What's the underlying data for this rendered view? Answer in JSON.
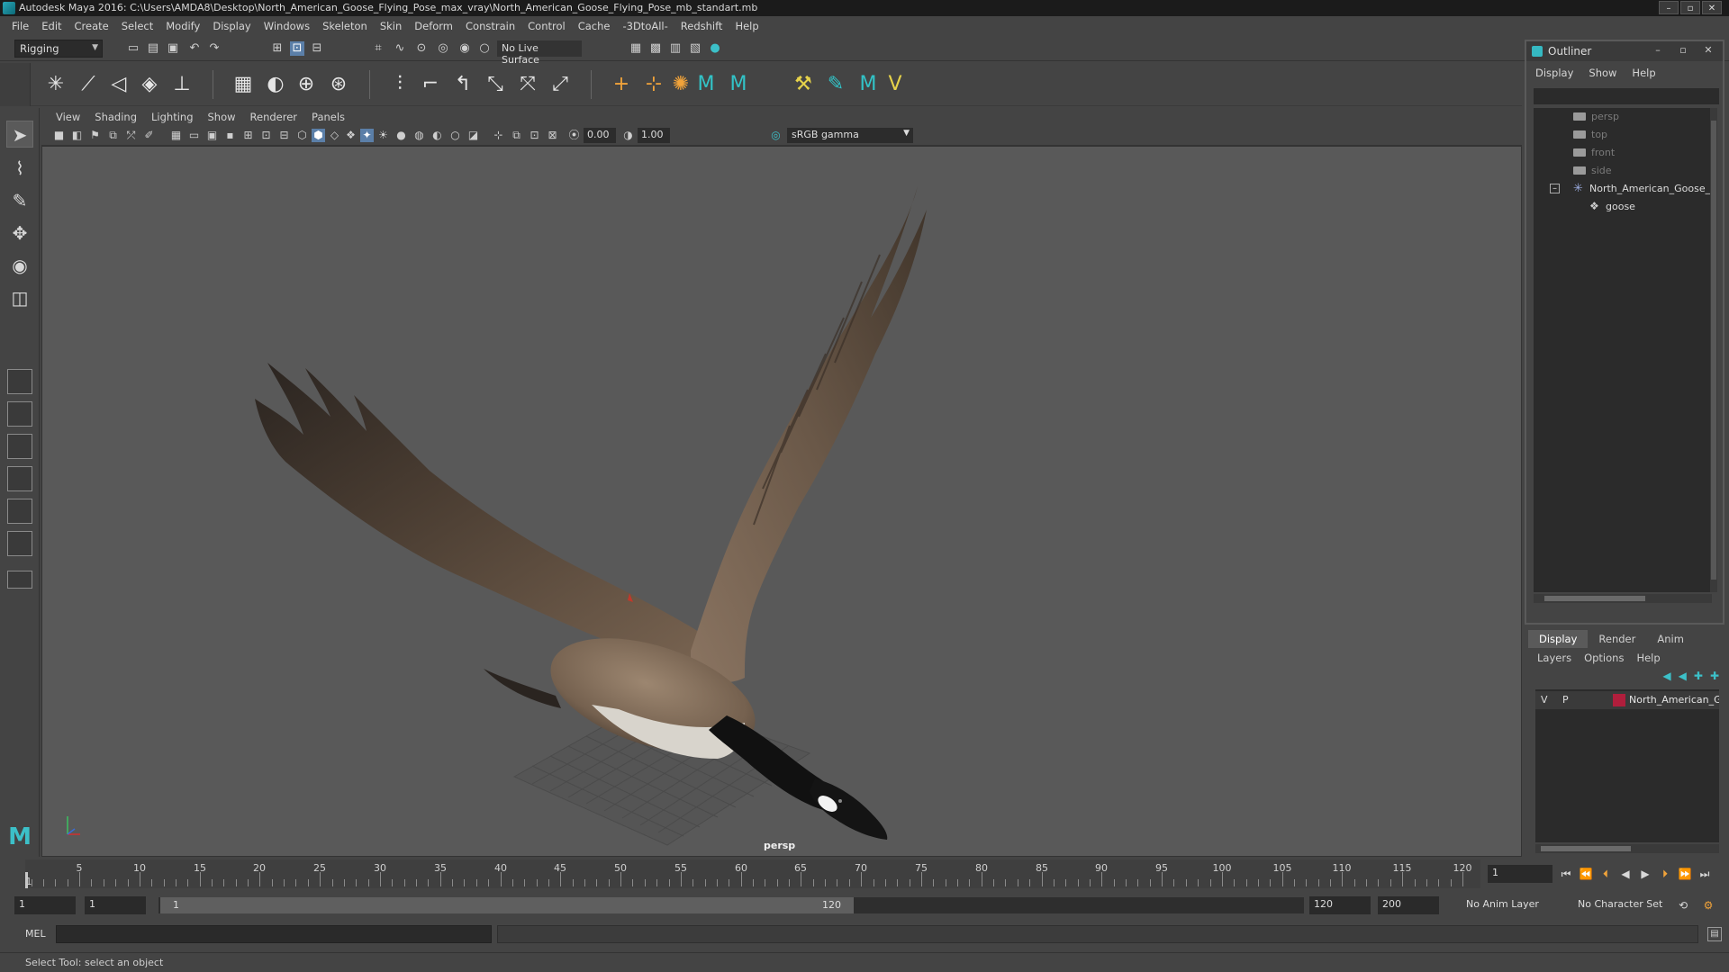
{
  "window": {
    "title": "Autodesk Maya 2016: C:\\Users\\AMDA8\\Desktop\\North_American_Goose_Flying_Pose_max_vray\\North_American_Goose_Flying_Pose_mb_standart.mb"
  },
  "menubar": [
    "File",
    "Edit",
    "Create",
    "Select",
    "Modify",
    "Display",
    "Windows",
    "Skeleton",
    "Skin",
    "Deform",
    "Constrain",
    "Control",
    "Cache",
    "-3DtoAll-",
    "Redshift",
    "Help"
  ],
  "statusline": {
    "mode": "Rigging",
    "live_surface": "No Live Surface"
  },
  "viewport": {
    "menu": [
      "View",
      "Shading",
      "Lighting",
      "Show",
      "Renderer",
      "Panels"
    ],
    "exposure": "0.00",
    "gamma": "1.00",
    "color_space": "sRGB gamma",
    "camera": "persp"
  },
  "outliner": {
    "title": "Outliner",
    "menu": [
      "Display",
      "Show",
      "Help"
    ],
    "items": [
      {
        "label": "persp",
        "type": "camera"
      },
      {
        "label": "top",
        "type": "camera"
      },
      {
        "label": "front",
        "type": "camera"
      },
      {
        "label": "side",
        "type": "camera"
      },
      {
        "label": "North_American_Goose_F",
        "type": "joint"
      },
      {
        "label": "goose",
        "type": "mesh"
      }
    ]
  },
  "layer_editor": {
    "tabs": [
      "Display",
      "Render",
      "Anim"
    ],
    "active_tab": "Display",
    "menu": [
      "Layers",
      "Options",
      "Help"
    ],
    "layers": [
      {
        "visible": "V",
        "playback": "P",
        "name": "North_American_Goos",
        "color": "#b01e3c"
      }
    ]
  },
  "timeline": {
    "ticks": [
      "5",
      "10",
      "15",
      "20",
      "25",
      "30",
      "35",
      "40",
      "45",
      "50",
      "55",
      "60",
      "65",
      "70",
      "75",
      "80",
      "85",
      "90",
      "95",
      "100",
      "105",
      "110",
      "115",
      "120"
    ],
    "start_label": "1",
    "current_frame": "1"
  },
  "range": {
    "start": "1",
    "playback_start": "1",
    "range_start_label": "1",
    "range_end_label": "120",
    "playback_end": "120",
    "end": "200",
    "anim_layer": "No Anim Layer",
    "character_set": "No Character Set"
  },
  "cmdline": {
    "language": "MEL"
  },
  "helpline": {
    "text": "Select Tool: select an object"
  }
}
